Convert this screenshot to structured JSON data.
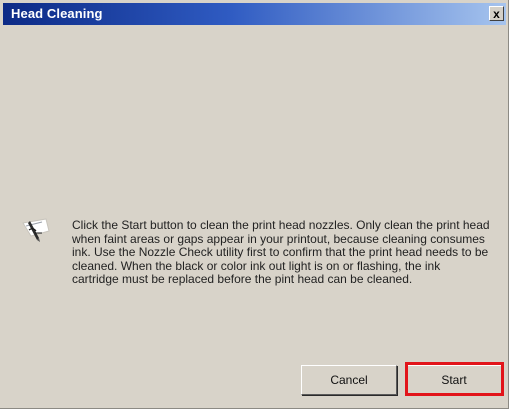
{
  "window": {
    "title": "Head Cleaning",
    "close_glyph": "x"
  },
  "icon": {
    "name": "pen-writing-icon"
  },
  "message": "Click the Start button to clean the print head nozzles. Only clean the print head when faint areas or gaps appear in your printout, because cleaning consumes ink. Use the Nozzle Check utility first to confirm that the print head needs to be cleaned. When the black or color ink out light is on or flashing, the ink cartridge must be replaced before the pint head can be cleaned.",
  "buttons": {
    "cancel_label": "Cancel",
    "start_label": "Start"
  },
  "colors": {
    "highlight": "#e2141a",
    "titlebar_start": "#0c2a86",
    "titlebar_end": "#a6c4ee",
    "dialog_bg": "#d8d3c9"
  }
}
